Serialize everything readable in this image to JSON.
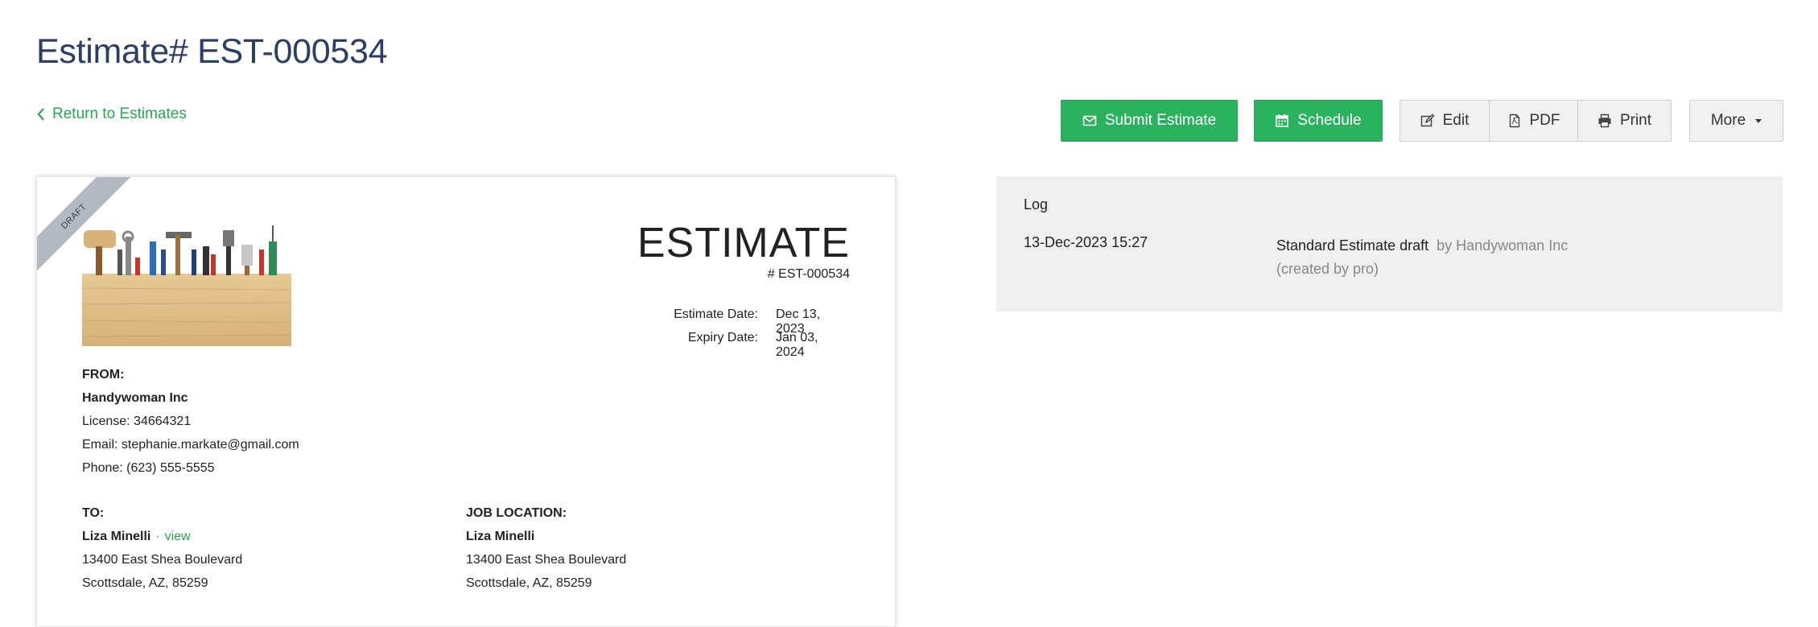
{
  "page": {
    "title": "Estimate# EST-000534",
    "back_link": "Return to Estimates"
  },
  "toolbar": {
    "submit_label": "Submit Estimate",
    "schedule_label": "Schedule",
    "edit_label": "Edit",
    "pdf_label": "PDF",
    "print_label": "Print",
    "more_label": "More",
    "accent_color": "#2ab25f"
  },
  "estimate": {
    "ribbon": "DRAFT",
    "heading": "ESTIMATE",
    "number": "# EST-000534",
    "estimate_date_label": "Estimate Date:",
    "estimate_date": "Dec 13, 2023",
    "expiry_date_label": "Expiry Date:",
    "expiry_date": "Jan 03, 2024",
    "from": {
      "label": "FROM:",
      "company": "Handywoman Inc",
      "license": "License: 34664321",
      "email": "Email: stephanie.markate@gmail.com",
      "phone": "Phone: (623) 555-5555"
    },
    "to": {
      "label": "TO:",
      "name": "Liza Minelli",
      "separator": "·",
      "view_link": "view",
      "street": "13400 East Shea Boulevard",
      "city": "Scottsdale, AZ, 85259"
    },
    "job_location": {
      "label": "JOB LOCATION:",
      "name": "Liza Minelli",
      "street": "13400 East Shea Boulevard",
      "city": "Scottsdale, AZ, 85259"
    }
  },
  "log": {
    "title": "Log",
    "entries": [
      {
        "timestamp": "13-Dec-2023 15:27",
        "action": "Standard Estimate draft",
        "by": "by Handywoman Inc",
        "note": "(created by pro)"
      }
    ]
  }
}
